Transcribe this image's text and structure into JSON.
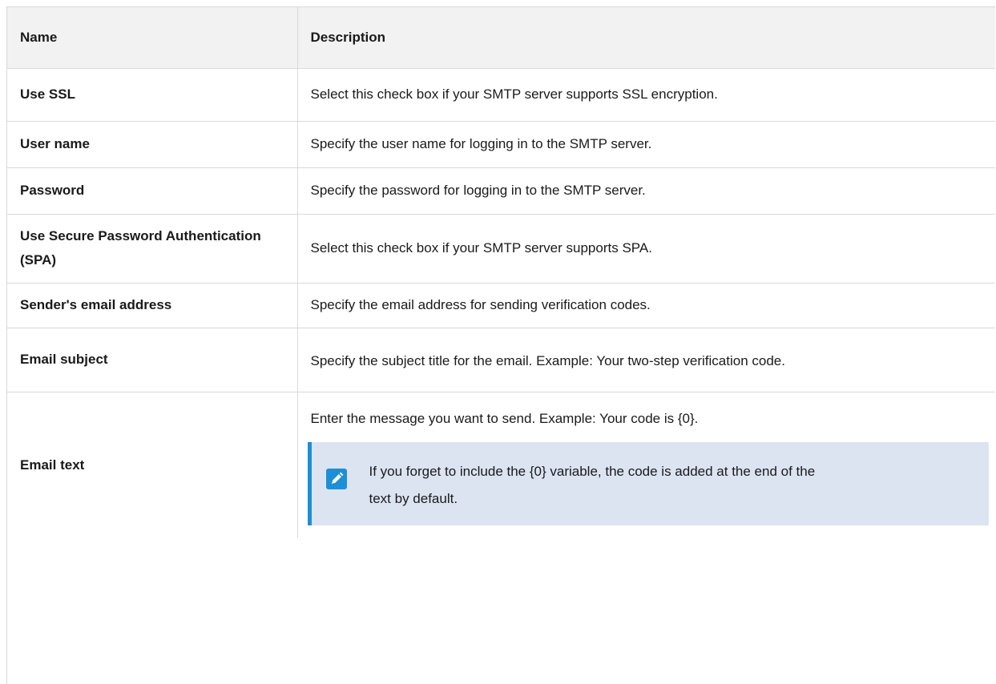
{
  "table": {
    "headers": {
      "name": "Name",
      "description": "Description"
    },
    "rows": [
      {
        "name": "Use SSL",
        "description": "Select this check box if your SMTP server supports SSL encryption."
      },
      {
        "name": "User name",
        "description": "Specify the user name for logging in to the SMTP server."
      },
      {
        "name": "Password",
        "description": "Specify the password for logging in to the SMTP server."
      },
      {
        "name": "Use Secure Password Authentication (SPA)",
        "description": "Select this check box if your SMTP server supports SPA."
      },
      {
        "name": "Sender's email address",
        "description": "Specify the email address for sending verification codes."
      },
      {
        "name": "Email subject",
        "description": "Specify the subject title for the email. Example: Your two-step verification code."
      },
      {
        "name": "Email text",
        "description": "Enter the message you want to send. Example: Your code is {0}.",
        "note": {
          "icon": "pencil-icon",
          "text": "If you forget to include the {0} variable, the code is added at the end of the text by default."
        }
      }
    ]
  },
  "colors": {
    "header_bg": "#f2f2f2",
    "border": "#d9d9d9",
    "note_bg": "#dce4f2",
    "note_accent": "#1d8fd6"
  }
}
